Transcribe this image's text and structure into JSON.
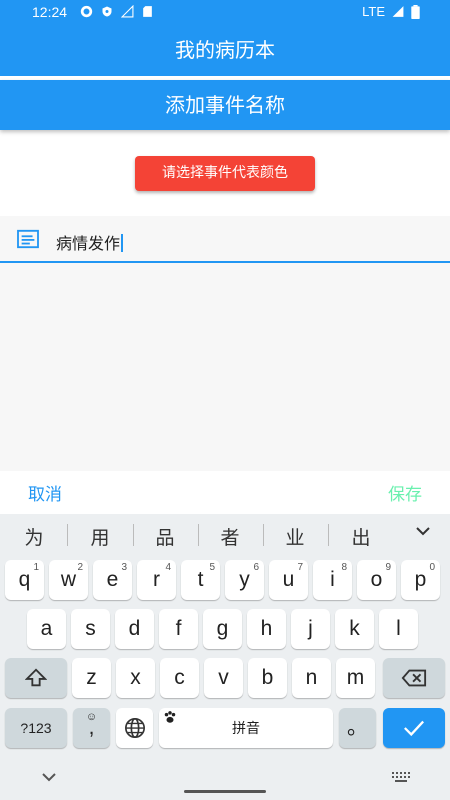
{
  "status_bar": {
    "time": "12:24",
    "network": "LTE"
  },
  "app_bar": {
    "title": "我的病历本"
  },
  "sub_bar": {
    "title": "添加事件名称"
  },
  "color_button": {
    "label": "请选择事件代表颜色",
    "color": "#F44336"
  },
  "input": {
    "value": "病情发作"
  },
  "actions": {
    "cancel": "取消",
    "save": "保存"
  },
  "keyboard": {
    "suggestions": [
      "为",
      "用",
      "品",
      "者",
      "业",
      "出"
    ],
    "row1": [
      {
        "k": "q",
        "n": "1"
      },
      {
        "k": "w",
        "n": "2"
      },
      {
        "k": "e",
        "n": "3"
      },
      {
        "k": "r",
        "n": "4"
      },
      {
        "k": "t",
        "n": "5"
      },
      {
        "k": "y",
        "n": "6"
      },
      {
        "k": "u",
        "n": "7"
      },
      {
        "k": "i",
        "n": "8"
      },
      {
        "k": "o",
        "n": "9"
      },
      {
        "k": "p",
        "n": "0"
      }
    ],
    "row2": [
      "a",
      "s",
      "d",
      "f",
      "g",
      "h",
      "j",
      "k",
      "l"
    ],
    "row3": [
      "z",
      "x",
      "c",
      "v",
      "b",
      "n",
      "m"
    ],
    "symbols_label": "?123",
    "comma_label": ",",
    "space_label": "拼音",
    "period_label": "。"
  },
  "colors": {
    "primary": "#2196F3",
    "save": "#69F0AE",
    "keyboard_bg": "#ECEFF1"
  }
}
